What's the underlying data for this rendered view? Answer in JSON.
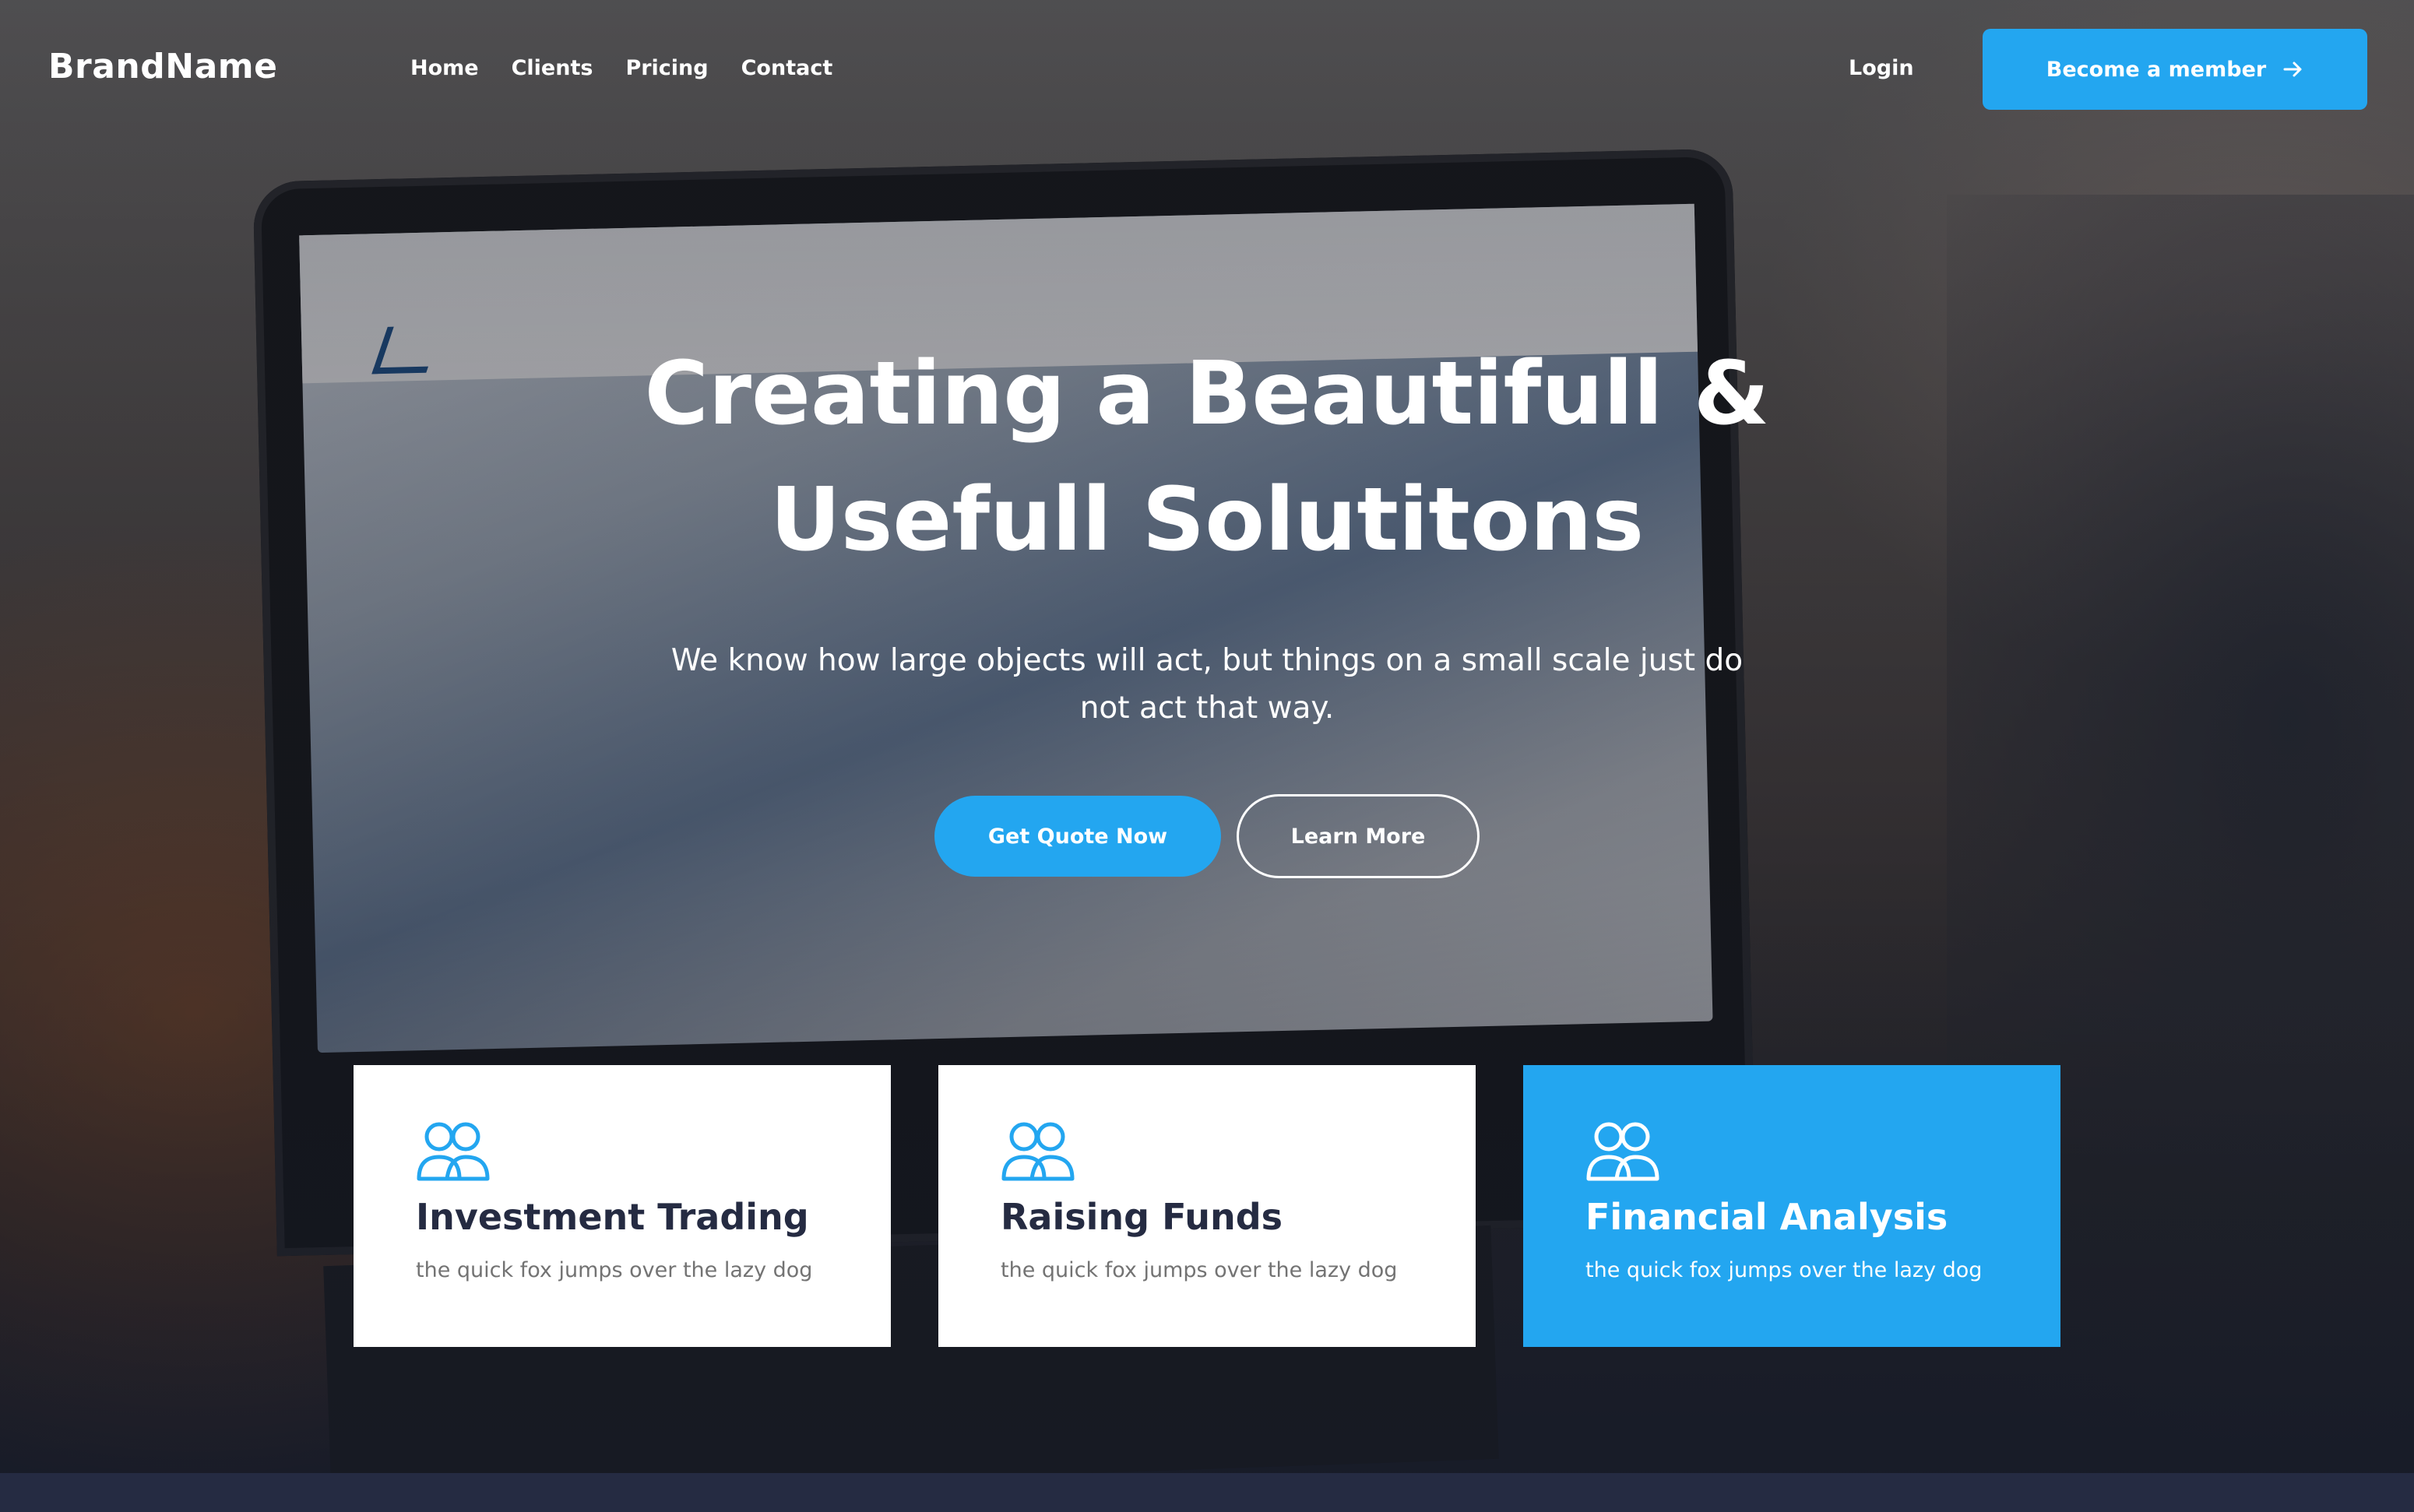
{
  "colors": {
    "primary": "#23a6f0",
    "dark": "#252b42",
    "muted": "#737373",
    "white": "#ffffff"
  },
  "nav": {
    "brand": "BrandName",
    "links": [
      "Home",
      "Clients",
      "Pricing",
      "Contact"
    ],
    "login": "Login",
    "cta": "Become a member",
    "cta_icon": "arrow-right-icon"
  },
  "hero": {
    "title_line1": "Creating a Beautifull &",
    "title_line2": "Usefull Solutitons",
    "subtitle": "We know how large objects will act, but things on a small scale just do not act that way.",
    "primary_button": "Get Quote Now",
    "secondary_button": "Learn More"
  },
  "cards": [
    {
      "title": "Investment Trading",
      "text": "the quick fox jumps over the lazy dog",
      "icon": "users-icon",
      "highlighted": false
    },
    {
      "title": "Raising Funds",
      "text": "the quick fox jumps over the lazy dog",
      "icon": "users-icon",
      "highlighted": false
    },
    {
      "title": "Financial Analysis",
      "text": "the quick fox jumps over the lazy dog",
      "icon": "users-icon",
      "highlighted": true
    }
  ]
}
